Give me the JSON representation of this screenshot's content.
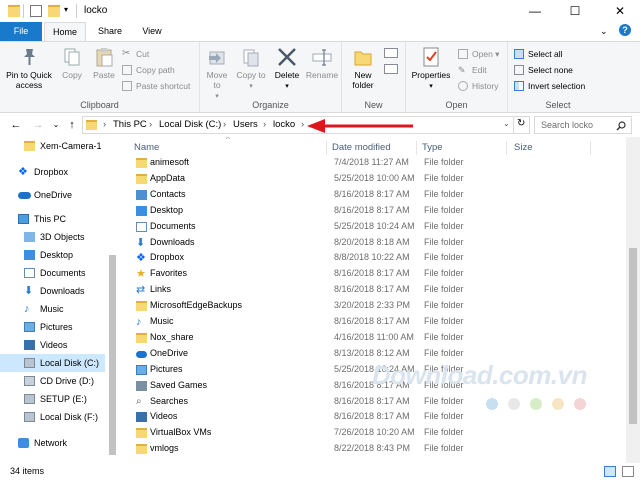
{
  "window": {
    "title": "locko"
  },
  "tabs": {
    "file": "File",
    "home": "Home",
    "share": "Share",
    "view": "View"
  },
  "ribbon": {
    "clipboard": {
      "label": "Clipboard",
      "pin": "Pin to Quick access",
      "copy": "Copy",
      "paste": "Paste",
      "cut": "Cut",
      "copy_path": "Copy path",
      "paste_shortcut": "Paste shortcut"
    },
    "organize": {
      "label": "Organize",
      "move_to": "Move to",
      "copy_to": "Copy to",
      "delete": "Delete",
      "rename": "Rename"
    },
    "new": {
      "label": "New",
      "new_folder": "New folder"
    },
    "open": {
      "label": "Open",
      "properties": "Properties",
      "open": "Open",
      "edit": "Edit",
      "history": "History"
    },
    "select": {
      "label": "Select",
      "select_all": "Select all",
      "select_none": "Select none",
      "invert": "Invert selection"
    }
  },
  "address": {
    "crumbs": [
      "This PC",
      "Local Disk (C:)",
      "Users",
      "locko"
    ],
    "search_placeholder": "Search locko"
  },
  "nav": [
    {
      "label": "Xem-Camera-1",
      "icon": "folder-icon"
    },
    {
      "label": "Dropbox",
      "icon": "dropbox-icon"
    },
    {
      "label": "OneDrive",
      "icon": "onedrive-icon"
    },
    {
      "label": "This PC",
      "icon": "computer-icon"
    },
    {
      "label": "3D Objects",
      "icon": "cube-icon"
    },
    {
      "label": "Desktop",
      "icon": "desktop-icon"
    },
    {
      "label": "Documents",
      "icon": "documents-icon"
    },
    {
      "label": "Downloads",
      "icon": "download-icon"
    },
    {
      "label": "Music",
      "icon": "music-icon"
    },
    {
      "label": "Pictures",
      "icon": "pictures-icon"
    },
    {
      "label": "Videos",
      "icon": "videos-icon"
    },
    {
      "label": "Local Disk (C:)",
      "icon": "drive-icon"
    },
    {
      "label": "CD Drive (D:)",
      "icon": "cd-drive-icon"
    },
    {
      "label": "SETUP (E:)",
      "icon": "drive-icon"
    },
    {
      "label": "Local Disk (F:)",
      "icon": "drive-icon"
    },
    {
      "label": "Network",
      "icon": "network-icon"
    }
  ],
  "columns": {
    "name": "Name",
    "date": "Date modified",
    "type": "Type",
    "size": "Size"
  },
  "files": [
    {
      "name": "animesoft",
      "date": "7/4/2018 11:27 AM",
      "type": "File folder",
      "icon": "folder-icon"
    },
    {
      "name": "AppData",
      "date": "5/25/2018 10:00 AM",
      "type": "File folder",
      "icon": "folder-icon"
    },
    {
      "name": "Contacts",
      "date": "8/16/2018 8:17 AM",
      "type": "File folder",
      "icon": "contacts-icon"
    },
    {
      "name": "Desktop",
      "date": "8/16/2018 8:17 AM",
      "type": "File folder",
      "icon": "desktop-icon"
    },
    {
      "name": "Documents",
      "date": "5/25/2018 10:24 AM",
      "type": "File folder",
      "icon": "documents-icon"
    },
    {
      "name": "Downloads",
      "date": "8/20/2018 8:18 AM",
      "type": "File folder",
      "icon": "download-icon"
    },
    {
      "name": "Dropbox",
      "date": "8/8/2018 10:22 AM",
      "type": "File folder",
      "icon": "dropbox-icon"
    },
    {
      "name": "Favorites",
      "date": "8/16/2018 8:17 AM",
      "type": "File folder",
      "icon": "star-icon"
    },
    {
      "name": "Links",
      "date": "8/16/2018 8:17 AM",
      "type": "File folder",
      "icon": "link-icon"
    },
    {
      "name": "MicrosoftEdgeBackups",
      "date": "3/20/2018 2:33 PM",
      "type": "File folder",
      "icon": "folder-icon"
    },
    {
      "name": "Music",
      "date": "8/16/2018 8:17 AM",
      "type": "File folder",
      "icon": "music-icon"
    },
    {
      "name": "Nox_share",
      "date": "4/16/2018 11:00 AM",
      "type": "File folder",
      "icon": "folder-icon"
    },
    {
      "name": "OneDrive",
      "date": "8/13/2018 8:12 AM",
      "type": "File folder",
      "icon": "onedrive-icon"
    },
    {
      "name": "Pictures",
      "date": "5/25/2018 10:24 AM",
      "type": "File folder",
      "icon": "pictures-icon"
    },
    {
      "name": "Saved Games",
      "date": "8/16/2018 8:17 AM",
      "type": "File folder",
      "icon": "games-icon"
    },
    {
      "name": "Searches",
      "date": "8/16/2018 8:17 AM",
      "type": "File folder",
      "icon": "search-icon"
    },
    {
      "name": "Videos",
      "date": "8/16/2018 8:17 AM",
      "type": "File folder",
      "icon": "videos-icon"
    },
    {
      "name": "VirtualBox VMs",
      "date": "7/26/2018 10:20 AM",
      "type": "File folder",
      "icon": "folder-icon"
    },
    {
      "name": "vmlogs",
      "date": "8/22/2018 8:43 PM",
      "type": "File folder",
      "icon": "folder-icon"
    }
  ],
  "status": {
    "items": "34 items"
  },
  "watermark": "Download.com.vn",
  "colors": {
    "accent": "#1979ca",
    "selected": "#cce8ff",
    "arrow": "#e0141d",
    "folder": "#f8d775"
  }
}
